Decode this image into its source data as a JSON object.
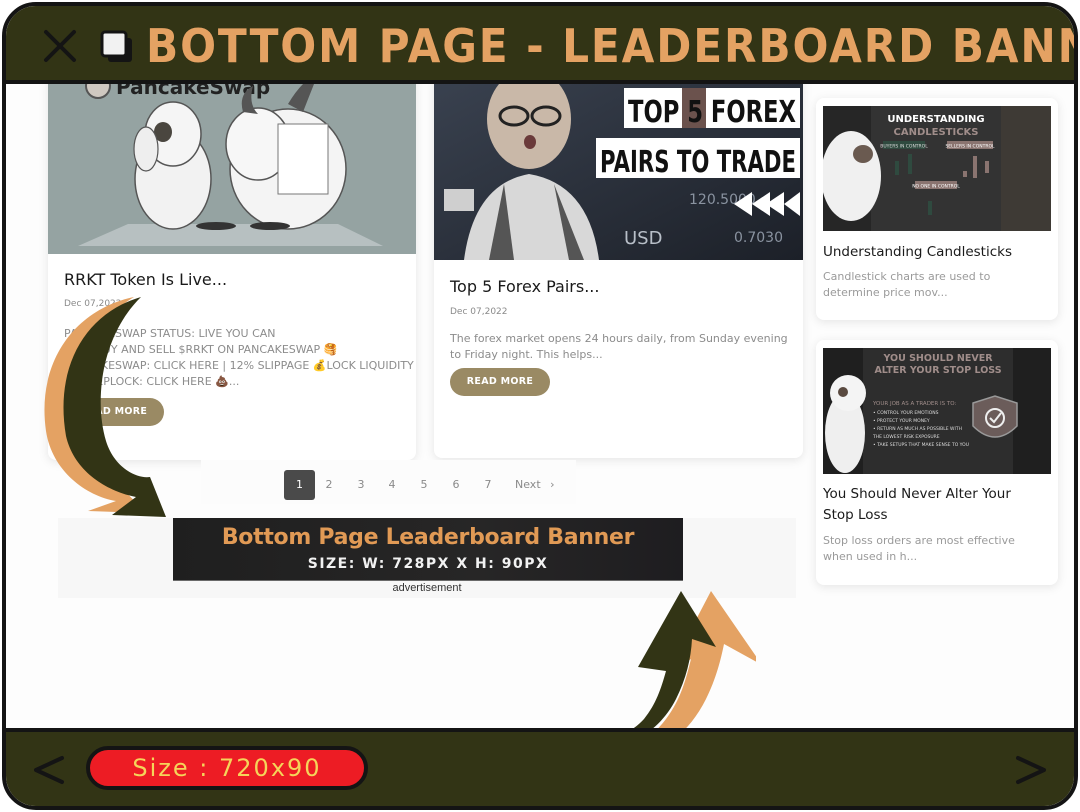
{
  "header": {
    "title": "Bottom Page - Leaderboard Banner",
    "close_icon": "close-icon",
    "copy_icon": "copy-icon"
  },
  "colors": {
    "frame_bg": "#323415",
    "title_color": "#e4a263",
    "pill_bg": "#ed1c24",
    "pill_text": "#f5d45a",
    "read_more_bg": "#9a8a64",
    "ad_title_color": "#e19a55"
  },
  "posts": [
    {
      "image_label": "PancakeSwap",
      "title": "RRKT Token Is Live...",
      "date": "Dec 07,2022",
      "excerpt_lines": [
        "PANCAKESWAP STATUS: LIVE YOU CAN",
        "NOW BUY AND SELL $RRKT ON PANCAKESWAP 🥞",
        "PANCAKESWAP: CLICK HERE | 12% SLIPPAGE 💰LOCK LIQUIDITY",
        "AT DEEPLOCK: CLICK HERE 💩..."
      ],
      "read_more": "READ MORE"
    },
    {
      "image_line1": "TOP 5 FOREX",
      "image_line2": "PAIRS TO TRADE",
      "title": "Top 5 Forex Pairs...",
      "date": "Dec 07,2022",
      "excerpt_lines": [
        "The forex market opens 24 hours daily, from Sunday evening",
        "to Friday night. This helps..."
      ],
      "read_more": "READ MORE"
    }
  ],
  "sidebar": [
    {
      "image_line1": "UNDERSTANDING",
      "image_line2": "CANDLESTICKS",
      "image_tags": [
        "BUYERS IN CONTROL",
        "SELLERS IN CONTROL",
        "NO ONE IN CONTROL"
      ],
      "title": "Understanding Candlesticks",
      "excerpt_lines": [
        "Candlestick charts are used to",
        "determine price mov..."
      ]
    },
    {
      "image_line1": "YOU SHOULD NEVER",
      "image_line2": "ALTER YOUR STOP LOSS",
      "image_bullets": [
        "• CONTROL YOUR EMOTIONS",
        "• PROTECT YOUR MONEY",
        "• RETURN AS MUCH AS POSSIBLE WITH",
        "  THE LOWEST RISK EXPOSURE",
        "• TAKE SETUPS THAT MAKE SENSE TO YOU"
      ],
      "image_subhead": "YOUR JOB AS A TRADER IS TO:",
      "title_lines": [
        "You Should Never Alter Your",
        "Stop Loss"
      ],
      "excerpt_lines": [
        "Stop loss orders are most effective",
        "when used in h..."
      ]
    }
  ],
  "pagination": {
    "pages": [
      "1",
      "2",
      "3",
      "4",
      "5",
      "6",
      "7"
    ],
    "active": "1",
    "next_label": "Next",
    "next_icon": "chevron-right-icon"
  },
  "ad": {
    "title": "Bottom Page Leaderboard Banner",
    "size_text": "SIZE: W: 728PX X H: 90PX",
    "label": "advertisement"
  },
  "footer": {
    "size_pill": "Size : 720x90",
    "prev_icon": "chevron-left-icon",
    "next_icon": "chevron-right-icon"
  }
}
